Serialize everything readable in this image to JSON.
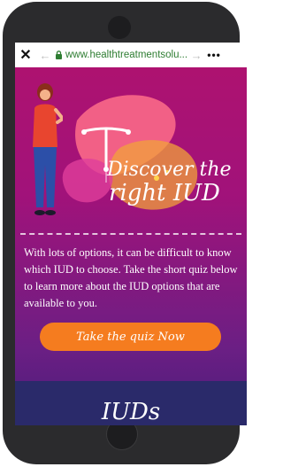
{
  "browser": {
    "close_icon": "close-icon",
    "back_icon": "back-arrow-icon",
    "lock_icon": "lock-icon",
    "url": "www.healthtreatmentsolu...",
    "forward_icon": "forward-arrow-icon",
    "more_icon": "more-icon"
  },
  "hero": {
    "headline_line1": "Discover the",
    "headline_line2": "right IUD"
  },
  "body": {
    "description": "With lots of options, it can be difficult to know which IUD to choose. Take the short quiz below to learn more about the IUD options that are available to you."
  },
  "cta": {
    "label": "Take the quiz Now"
  },
  "section2": {
    "title": "IUDs"
  },
  "colors": {
    "gradient_top": "#b0126e",
    "gradient_bottom": "#4a1c7a",
    "cta": "#f57c1f",
    "url_green": "#2e7d32",
    "section2_bg": "#2a2a6a"
  }
}
